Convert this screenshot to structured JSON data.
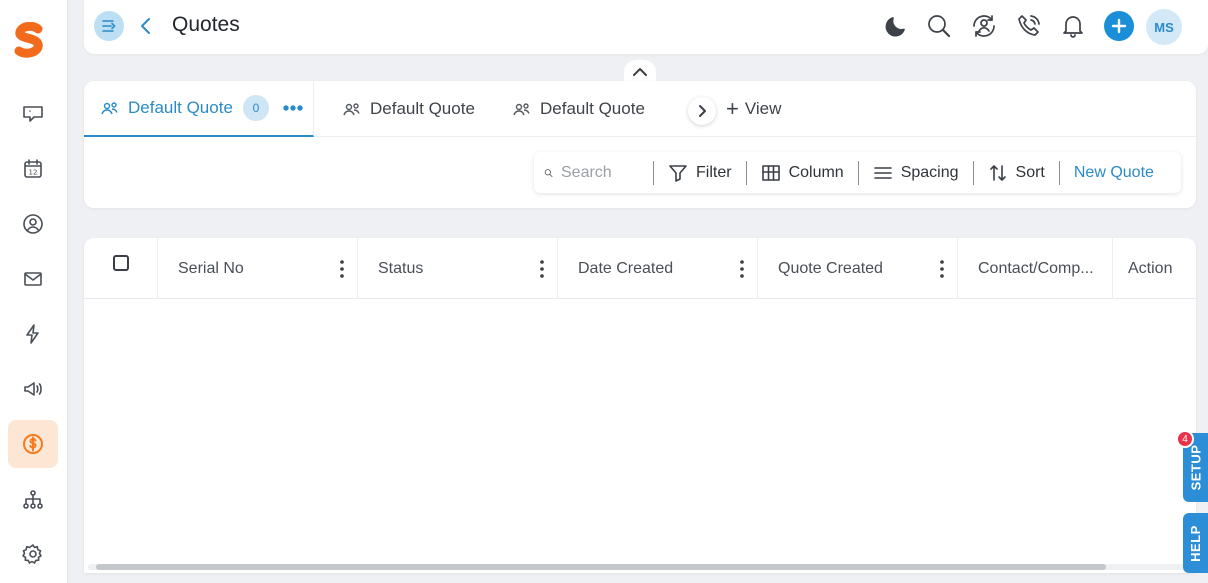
{
  "header": {
    "title": "Quotes",
    "avatar_initials": "MS",
    "icons": [
      "menu-toggle-icon",
      "back-chevron-icon",
      "moon-icon",
      "search-icon",
      "refresh-user-icon",
      "phone-call-icon",
      "bell-icon",
      "plus-icon"
    ]
  },
  "sidebar": {
    "items": [
      {
        "icon": "chat-icon"
      },
      {
        "icon": "calendar-icon",
        "label": "12"
      },
      {
        "icon": "user-circle-icon"
      },
      {
        "icon": "mail-icon"
      },
      {
        "icon": "lightning-icon"
      },
      {
        "icon": "megaphone-icon"
      },
      {
        "icon": "dollar-icon",
        "active": true
      },
      {
        "icon": "org-chart-icon"
      },
      {
        "icon": "gear-icon"
      }
    ]
  },
  "tabs": {
    "items": [
      {
        "label": "Default Quote",
        "count": "0",
        "active": true
      },
      {
        "label": "Default Quote"
      },
      {
        "label": "Default Quote"
      }
    ],
    "add_view_label": "View"
  },
  "toolbar": {
    "search_placeholder": "Search",
    "filter_label": "Filter",
    "column_label": "Column",
    "spacing_label": "Spacing",
    "sort_label": "Sort",
    "new_label": "New Quote"
  },
  "table": {
    "columns": [
      "Serial No",
      "Status",
      "Date Created",
      "Quote Created",
      "Contact/Comp...",
      "Action"
    ]
  },
  "floating": {
    "setup_label": "SETUP",
    "setup_badge": "4",
    "help_label": "HELP"
  },
  "colors": {
    "accent": "#2a8bc9",
    "brand": "#f47b20",
    "badge": "#e8334a"
  }
}
